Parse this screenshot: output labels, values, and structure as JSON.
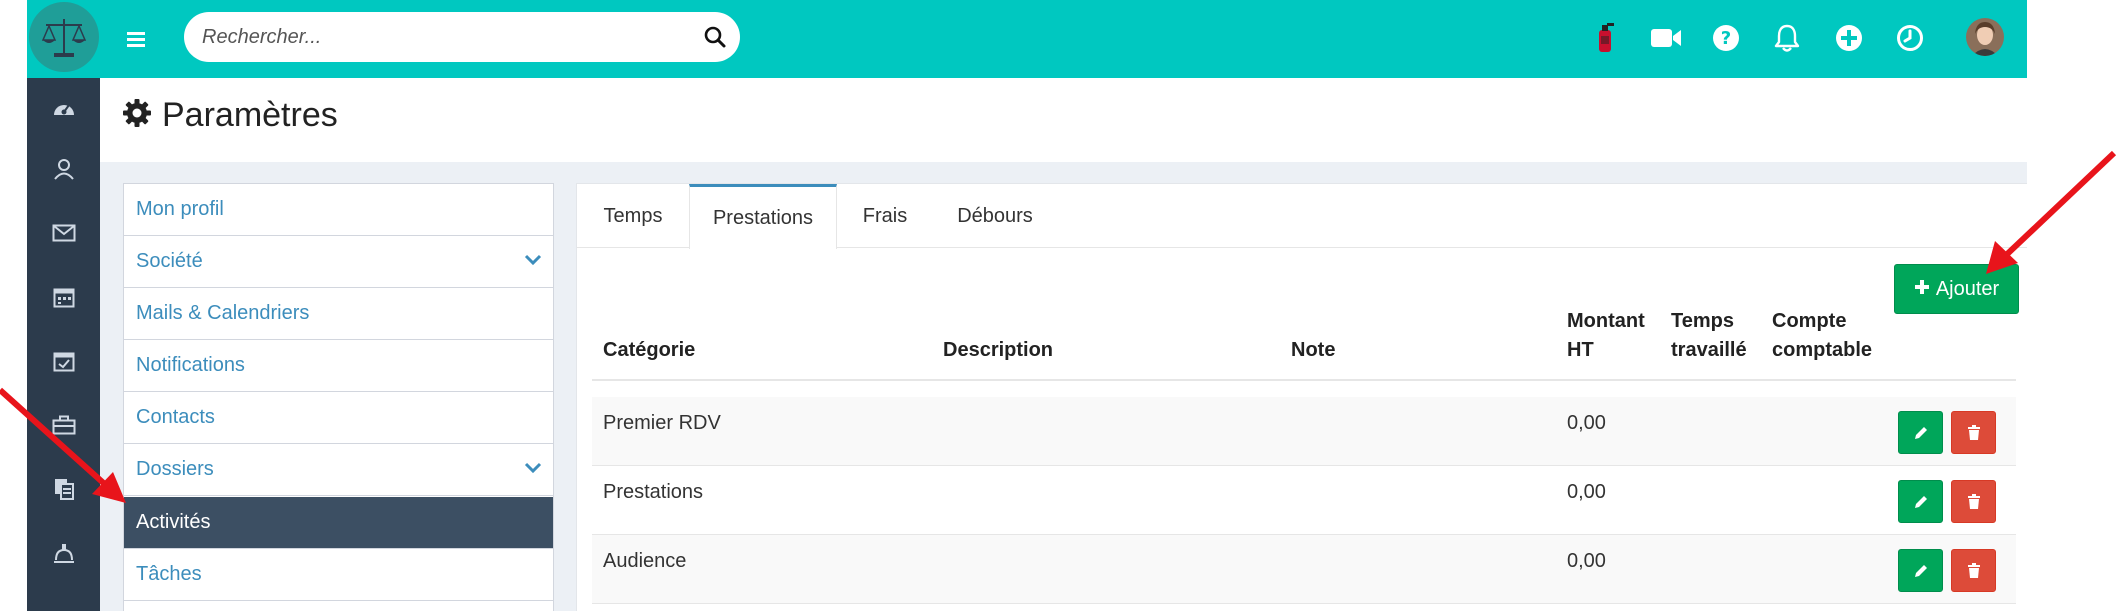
{
  "topbar": {
    "search_placeholder": "Rechercher...",
    "icons": [
      "logo-scales-icon",
      "hamburger-menu-icon",
      "search-icon",
      "fire-extinguisher-icon",
      "video-camera-icon",
      "help-circle-icon",
      "bell-icon",
      "plus-circle-icon",
      "clock-icon",
      "user-avatar"
    ]
  },
  "rail": {
    "icons": [
      "dashboard-icon",
      "contacts-icon",
      "mail-icon",
      "calendar-icon",
      "tasks-calendar-icon",
      "briefcase-icon",
      "documents-icon",
      "billing-icon"
    ]
  },
  "page": {
    "title": "Paramètres"
  },
  "settings_menu": {
    "items": [
      {
        "label": "Mon profil",
        "has_chevron": false,
        "active": false
      },
      {
        "label": "Société",
        "has_chevron": true,
        "active": false
      },
      {
        "label": "Mails & Calendriers",
        "has_chevron": false,
        "active": false
      },
      {
        "label": "Notifications",
        "has_chevron": false,
        "active": false
      },
      {
        "label": "Contacts",
        "has_chevron": false,
        "active": false
      },
      {
        "label": "Dossiers",
        "has_chevron": true,
        "active": false
      },
      {
        "label": "Activités",
        "has_chevron": false,
        "active": true
      },
      {
        "label": "Tâches",
        "has_chevron": false,
        "active": false
      }
    ]
  },
  "tabs": [
    {
      "label": "Temps",
      "active": false
    },
    {
      "label": "Prestations",
      "active": true
    },
    {
      "label": "Frais",
      "active": false
    },
    {
      "label": "Débours",
      "active": false
    }
  ],
  "add_button": {
    "label": "Ajouter"
  },
  "table": {
    "headers": {
      "categorie": "Catégorie",
      "description": "Description",
      "note": "Note",
      "montant_line1": "Montant",
      "montant_line2": "HT",
      "temps_line1": "Temps",
      "temps_line2": "travaillé",
      "compte_line1": "Compte",
      "compte_line2": "comptable"
    },
    "rows": [
      {
        "categorie": "Premier RDV",
        "description": "",
        "note": "",
        "montant": "0,00",
        "temps": "",
        "compte": ""
      },
      {
        "categorie": "Prestations",
        "description": "",
        "note": "",
        "montant": "0,00",
        "temps": "",
        "compte": ""
      },
      {
        "categorie": "Audience",
        "description": "",
        "note": "",
        "montant": "0,00",
        "temps": "",
        "compte": ""
      }
    ]
  },
  "colors": {
    "topbar": "#00c8c0",
    "rail": "#2c3b4c",
    "link": "#3c8dbc",
    "active_menu": "#3c4f63",
    "success": "#00a65a",
    "danger": "#dd4b39",
    "annotation_arrow": "#e8141b"
  }
}
